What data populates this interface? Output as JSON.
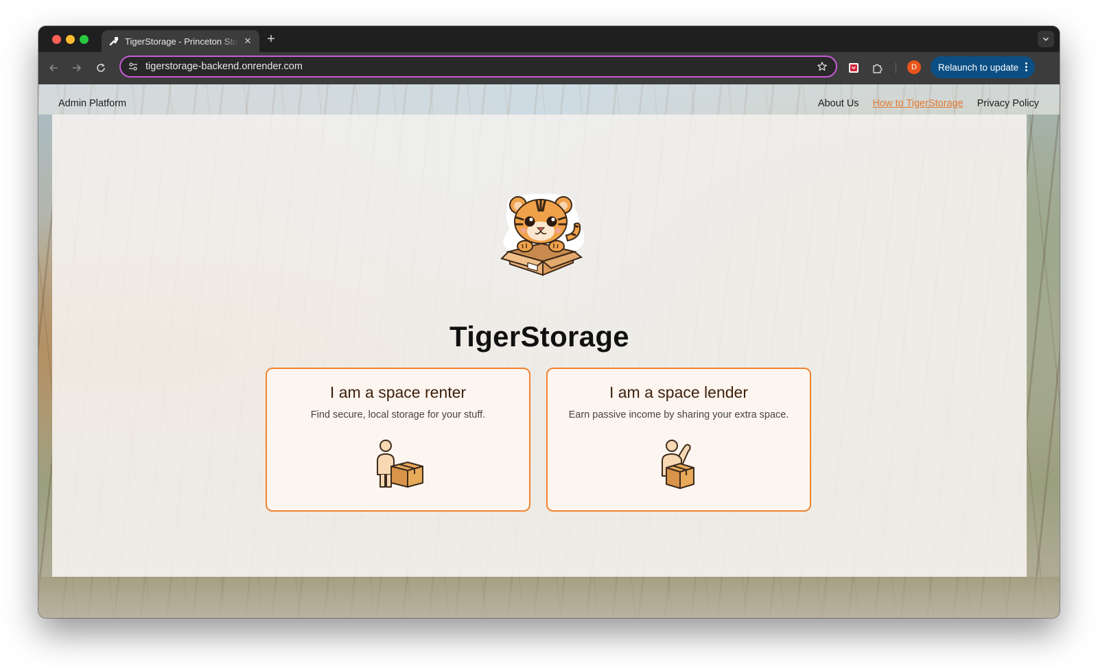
{
  "browser": {
    "tab_title": "TigerStorage - Princeton Storage",
    "url": "tigerstorage-backend.onrender.com",
    "relaunch_label": "Relaunch to update",
    "profile_initial": "D",
    "icons": [
      "back-arrow-icon",
      "forward-arrow-icon",
      "reload-icon",
      "site-settings-icon",
      "bookmark-star-icon",
      "extension-icon",
      "puzzle-extensions-icon",
      "more-vert-icon",
      "chevron-down-icon",
      "plus-icon",
      "close-icon"
    ]
  },
  "nav": {
    "admin": "Admin Platform",
    "links": [
      {
        "label": "About Us",
        "active": false
      },
      {
        "label": "How to TigerStorage",
        "active": true
      },
      {
        "label": "Privacy Policy",
        "active": false
      }
    ]
  },
  "hero": {
    "brand": "TigerStorage"
  },
  "cards": {
    "renter": {
      "title": "I am a space renter",
      "subtitle": "Find secure, local storage for your stuff."
    },
    "lender": {
      "title": "I am a space lender",
      "subtitle": "Earn passive income by sharing your extra space."
    }
  },
  "colors": {
    "accent": "#f0832f",
    "active_link": "#e07a34",
    "relaunch_bg": "#0b4f85",
    "omnibox_border": "#c959d8"
  }
}
